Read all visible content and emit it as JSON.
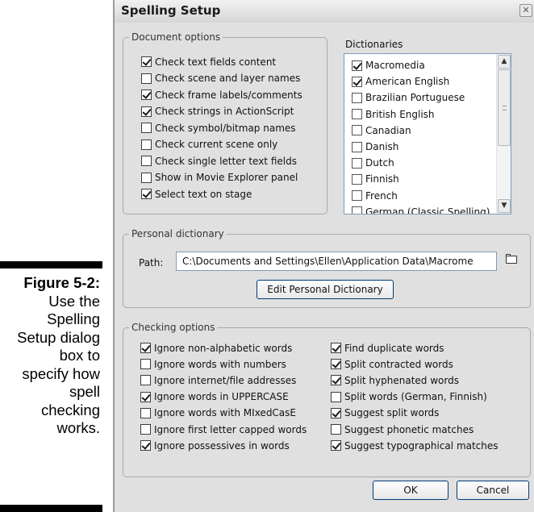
{
  "caption": {
    "figure": "Figure 5-2:",
    "lines": [
      "Use the",
      "Spelling",
      "Setup dialog",
      "box to",
      "specify how",
      "spell",
      "checking",
      "works."
    ]
  },
  "dialog": {
    "title": "Spelling Setup",
    "close_glyph": "✕"
  },
  "document_options": {
    "label": "Document options",
    "items": [
      {
        "label": "Check text fields content",
        "checked": true
      },
      {
        "label": "Check scene and layer names",
        "checked": false
      },
      {
        "label": "Check frame labels/comments",
        "checked": true
      },
      {
        "label": "Check strings in ActionScript",
        "checked": true
      },
      {
        "label": "Check symbol/bitmap names",
        "checked": false
      },
      {
        "label": "Check current scene only",
        "checked": false
      },
      {
        "label": "Check single letter text fields",
        "checked": false
      },
      {
        "label": "Show in Movie Explorer panel",
        "checked": false
      },
      {
        "label": "Select text on stage",
        "checked": true
      }
    ]
  },
  "dictionaries": {
    "label": "Dictionaries",
    "items": [
      {
        "label": "Macromedia",
        "checked": true
      },
      {
        "label": "American English",
        "checked": true
      },
      {
        "label": "Brazilian Portuguese",
        "checked": false
      },
      {
        "label": "British English",
        "checked": false
      },
      {
        "label": "Canadian",
        "checked": false
      },
      {
        "label": "Danish",
        "checked": false
      },
      {
        "label": "Dutch",
        "checked": false
      },
      {
        "label": "Finnish",
        "checked": false
      },
      {
        "label": "French",
        "checked": false
      },
      {
        "label": "German (Classic Spelling)",
        "checked": false
      }
    ],
    "scroll_up_glyph": "▲",
    "scroll_down_glyph": "▼"
  },
  "personal_dictionary": {
    "label": "Personal dictionary",
    "path_label": "Path:",
    "path_value": "C:\\Documents and Settings\\Ellen\\Application Data\\Macrome",
    "edit_button": "Edit Personal Dictionary"
  },
  "checking_options": {
    "label": "Checking options",
    "left": [
      {
        "label": "Ignore non-alphabetic words",
        "checked": true
      },
      {
        "label": "Ignore words with numbers",
        "checked": false
      },
      {
        "label": "Ignore internet/file addresses",
        "checked": false
      },
      {
        "label": "Ignore words in UPPERCASE",
        "checked": true
      },
      {
        "label": "Ignore words with MIxedCasE",
        "checked": false
      },
      {
        "label": "Ignore first letter capped words",
        "checked": false
      },
      {
        "label": "Ignore possessives in words",
        "checked": true
      }
    ],
    "right": [
      {
        "label": "Find duplicate words",
        "checked": true
      },
      {
        "label": "Split contracted words",
        "checked": true
      },
      {
        "label": "Split hyphenated words",
        "checked": true
      },
      {
        "label": "Split words (German, Finnish)",
        "checked": false
      },
      {
        "label": "Suggest split words",
        "checked": true
      },
      {
        "label": "Suggest phonetic matches",
        "checked": false
      },
      {
        "label": "Suggest typographical matches",
        "checked": true
      }
    ]
  },
  "buttons": {
    "ok": "OK",
    "cancel": "Cancel"
  }
}
